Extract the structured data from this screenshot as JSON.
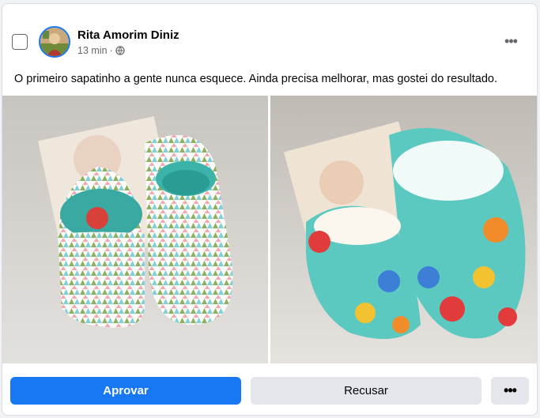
{
  "post": {
    "author": "Rita Amorim Diniz",
    "time": "13 min",
    "separator": "·",
    "privacy_icon": "globe-icon",
    "text": "O primeiro sapatinho a gente nunca esquece. Ainda precisa melhorar, mas gostei do resultado."
  },
  "menu": {
    "more_label": "•••"
  },
  "actions": {
    "approve_label": "Aprovar",
    "reject_label": "Recusar",
    "more_label": "•••"
  },
  "colors": {
    "primary": "#1877f2",
    "secondary_bg": "#e4e6eb",
    "muted_text": "#65676b"
  }
}
